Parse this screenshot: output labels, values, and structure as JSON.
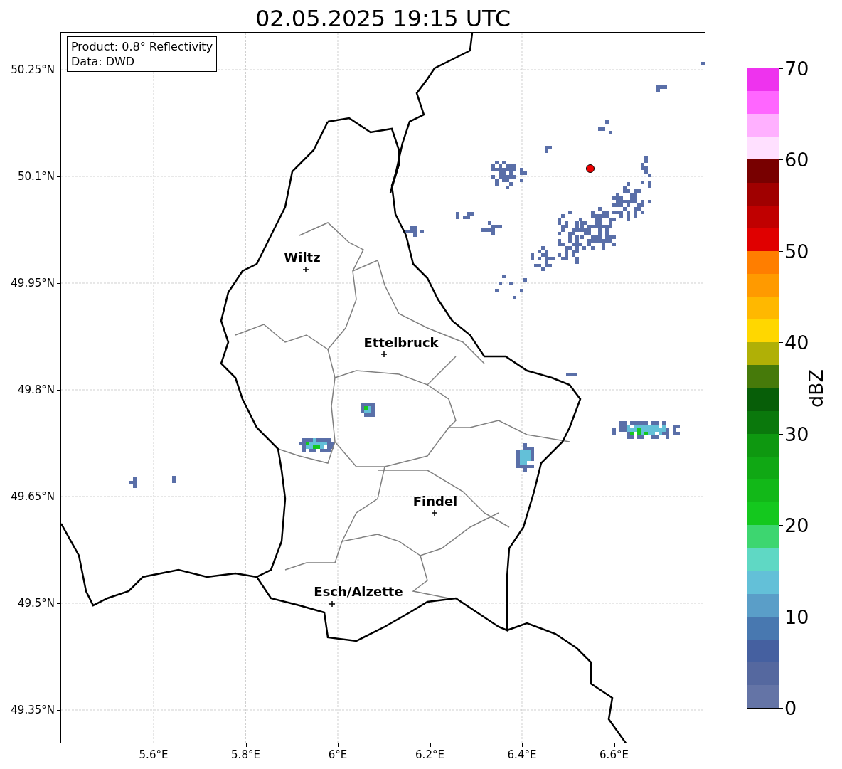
{
  "title": "02.05.2025 19:15 UTC",
  "info_box": [
    "Product: 0.8° Reflectivity",
    "Data: DWD"
  ],
  "y_ticks": [
    "50.25°N",
    "50.1°N",
    "49.95°N",
    "49.8°N",
    "49.65°N",
    "49.5°N",
    "49.35°N"
  ],
  "x_ticks": [
    "5.6°E",
    "5.8°E",
    "6°E",
    "6.2°E",
    "6.4°E",
    "6.6°E"
  ],
  "cities": [
    {
      "name": "Wiltz",
      "kind": "town"
    },
    {
      "name": "Ettelbruck",
      "kind": "town"
    },
    {
      "name": "Findel",
      "kind": "town"
    },
    {
      "name": "Esch/Alzette",
      "kind": "town"
    }
  ],
  "colorbar": {
    "label": "dBZ",
    "ticks": [
      "70",
      "60",
      "50",
      "40",
      "30",
      "20",
      "10",
      "0"
    ],
    "bands": [
      {
        "color": "#ee33ee"
      },
      {
        "color": "#ff66ff"
      },
      {
        "color": "#ffb0ff"
      },
      {
        "color": "#ffe0ff"
      },
      {
        "color": "#780000"
      },
      {
        "color": "#a00000"
      },
      {
        "color": "#c00000"
      },
      {
        "color": "#e00000"
      },
      {
        "color": "#ff7e00"
      },
      {
        "color": "#ff9a00"
      },
      {
        "color": "#ffb800"
      },
      {
        "color": "#ffd700"
      },
      {
        "color": "#b0b006"
      },
      {
        "color": "#467a0a"
      },
      {
        "color": "#075e08"
      },
      {
        "color": "#0a780c"
      },
      {
        "color": "#0e9810"
      },
      {
        "color": "#10a814"
      },
      {
        "color": "#12b818"
      },
      {
        "color": "#14c81e"
      },
      {
        "color": "#3dd670"
      },
      {
        "color": "#5fd8c4"
      },
      {
        "color": "#63c0d8"
      },
      {
        "color": "#5a9ec8"
      },
      {
        "color": "#4878b0"
      },
      {
        "color": "#4560a0"
      },
      {
        "color": "#55689f"
      },
      {
        "color": "#6474a6"
      }
    ]
  }
}
